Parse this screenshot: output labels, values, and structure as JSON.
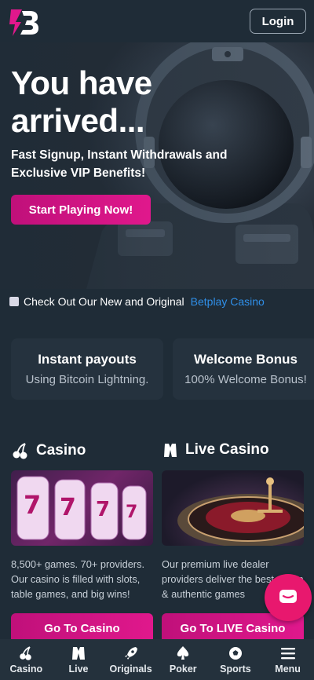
{
  "header": {
    "login_label": "Login",
    "logo_icon": "betplay-b-logo"
  },
  "hero": {
    "title": "You have arrived...",
    "subtitle": "Fast Signup, Instant Withdrawals and Exclusive VIP Benefits!",
    "cta_label": "Start Playing Now!"
  },
  "ticker": {
    "text": "Check Out Our New and Original",
    "link": "Betplay Casino"
  },
  "features": [
    {
      "title": "Instant payouts",
      "desc": "Using Bitcoin Lightning."
    },
    {
      "title": "Welcome Bonus",
      "desc": "100% Welcome Bonus!"
    }
  ],
  "sections": [
    {
      "title": "Casino",
      "icon": "cherries-icon",
      "desc": "8,500+ games. 70+ providers. Our casino is filled with slots, table games, and big wins!",
      "button": "Go To Casino"
    },
    {
      "title": "Live Casino",
      "icon": "tuxedo-icon",
      "desc": "Our premium live dealer providers deliver the best action & authentic games",
      "button": "Go To LIVE Casino"
    }
  ],
  "chat": {
    "icon": "chat-icon"
  },
  "bottom_nav": [
    {
      "label": "Casino",
      "icon": "cherries-icon"
    },
    {
      "label": "Live",
      "icon": "tuxedo-icon"
    },
    {
      "label": "Originals",
      "icon": "rocket-icon"
    },
    {
      "label": "Poker",
      "icon": "spade-icon"
    },
    {
      "label": "Sports",
      "icon": "ball-icon"
    },
    {
      "label": "Menu",
      "icon": "hamburger-icon"
    }
  ],
  "colors": {
    "accent": "#e0188c",
    "link": "#2f8fe8",
    "background": "#1f2c37"
  }
}
